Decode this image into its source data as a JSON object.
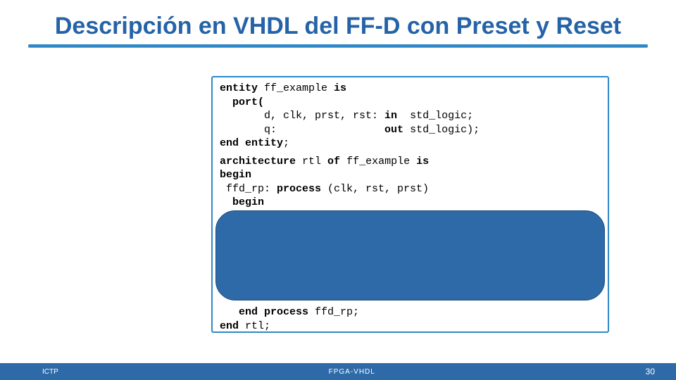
{
  "title": "Descripción en VHDL del FF-D con Preset y Reset",
  "code": {
    "l1a": "entity",
    "l1b": " ff_example ",
    "l1c": "is",
    "l2a": "  port(",
    "l3a": "       d, clk, prst, rst: ",
    "l3b": "in",
    "l3c": "  std_logic;",
    "l4a": "       q:                 ",
    "l4b": "out",
    "l4c": " std_logic);",
    "l5a": "end entity",
    "l5b": ";",
    "l6a": "architecture",
    "l6b": " rtl ",
    "l6c": "of",
    "l6d": " ff_example ",
    "l6e": "is",
    "l7a": "begin",
    "l8a": " ffd_rp: ",
    "l8b": "process",
    "l8c": " (clk, rst, prst)",
    "l9a": "  begin",
    "l15a": "   end process",
    "l15b": " ffd_rp;",
    "l16a": "end",
    "l16b": " rtl;"
  },
  "footer": {
    "left": "ICTP",
    "center": "FPGA-VHDL",
    "right": "30"
  }
}
